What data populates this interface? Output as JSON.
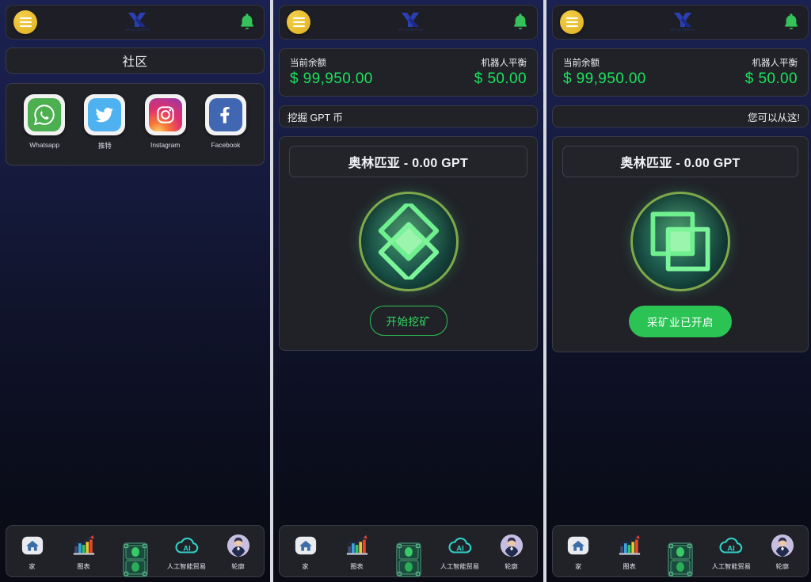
{
  "app": {
    "brand_sub": "GPT AI CRYPTO",
    "menu_icon": "hamburger-icon",
    "bell_icon": "bell-icon"
  },
  "panels": [
    {
      "id": "community",
      "section_title": "社区",
      "socials": [
        {
          "name": "Whatsapp",
          "icon": "whatsapp-icon"
        },
        {
          "name": "推特",
          "icon": "twitter-icon"
        },
        {
          "name": "Instagram",
          "icon": "instagram-icon"
        },
        {
          "name": "Facebook",
          "icon": "facebook-icon"
        }
      ]
    },
    {
      "id": "mining-idle",
      "balance": {
        "current_label": "当前余额",
        "current_value": "$ 99,950.00",
        "bot_label": "机器人平衡",
        "bot_value": "$ 50.00"
      },
      "marquee": "挖掘 GPT 币",
      "marquee_align": "left",
      "mining": {
        "coin_title": "奥林匹亚 - 0.00 GPT",
        "button_label": "开始挖矿",
        "button_style": "outline",
        "coin_icon": "gpt-coin-icon"
      }
    },
    {
      "id": "mining-active",
      "balance": {
        "current_label": "当前余额",
        "current_value": "$ 99,950.00",
        "bot_label": "机器人平衡",
        "bot_value": "$ 50.00"
      },
      "marquee": "您可以从这!",
      "marquee_align": "right",
      "mining": {
        "coin_title": "奥林匹亚 - 0.00 GPT",
        "button_label": "采矿业已开启",
        "button_style": "solid",
        "coin_icon": "gpt-coin-icon"
      }
    }
  ],
  "nav": [
    {
      "label": "家",
      "icon": "home-icon"
    },
    {
      "label": "图表",
      "icon": "bar-chart-icon"
    },
    {
      "label": "",
      "icon": "money-stack-icon"
    },
    {
      "label": "人工智能贸易",
      "icon": "ai-cloud-icon"
    },
    {
      "label": "轮廓",
      "icon": "profile-avatar-icon"
    }
  ],
  "colors": {
    "accent_green": "#19e35a",
    "brand_blue": "#2a3ba0",
    "menu_yellow": "#e5b92d",
    "card_bg": "#212228",
    "page_top": "#1b2150"
  }
}
